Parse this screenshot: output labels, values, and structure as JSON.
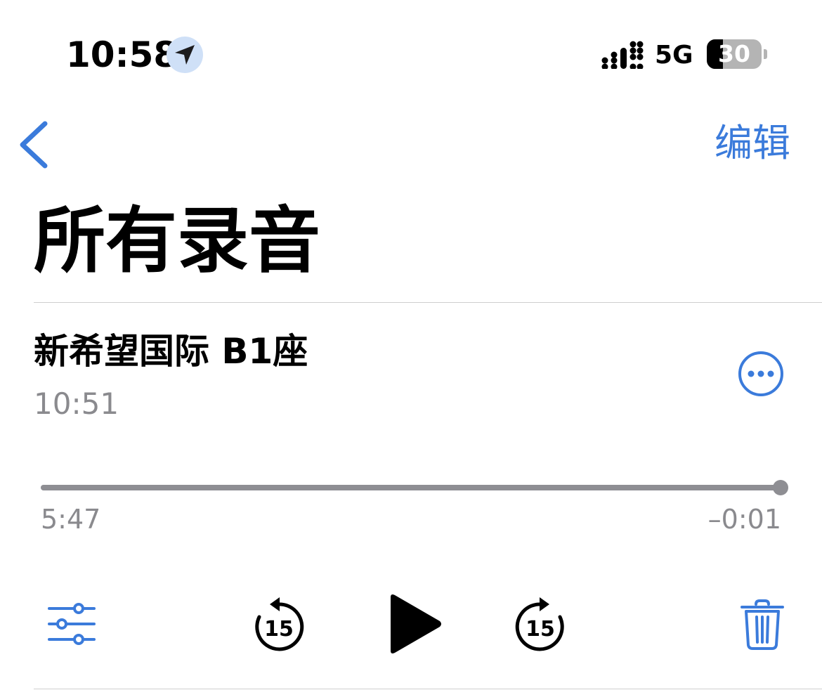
{
  "status_bar": {
    "time": "10:58",
    "network": "5G",
    "battery": "30",
    "battery_level": 0.3
  },
  "nav": {
    "edit_label": "编辑"
  },
  "page": {
    "title": "所有录音"
  },
  "recording": {
    "title": "新希望国际 B1座",
    "time": "10:51",
    "elapsed": "5:47",
    "remaining": "–0:01",
    "progress": 0.997
  },
  "colors": {
    "accent": "#3b7bdb",
    "secondary_text": "#8a8a8e"
  },
  "controls": {
    "skip_back_seconds": "15",
    "skip_forward_seconds": "15"
  },
  "icons": {
    "location": "location-arrow-icon",
    "back": "chevron-left-icon",
    "more": "ellipsis-circle-icon",
    "options": "sliders-icon",
    "skip_back": "gobackward-15-icon",
    "play": "play-icon",
    "skip_forward": "goforward-15-icon",
    "delete": "trash-icon"
  }
}
